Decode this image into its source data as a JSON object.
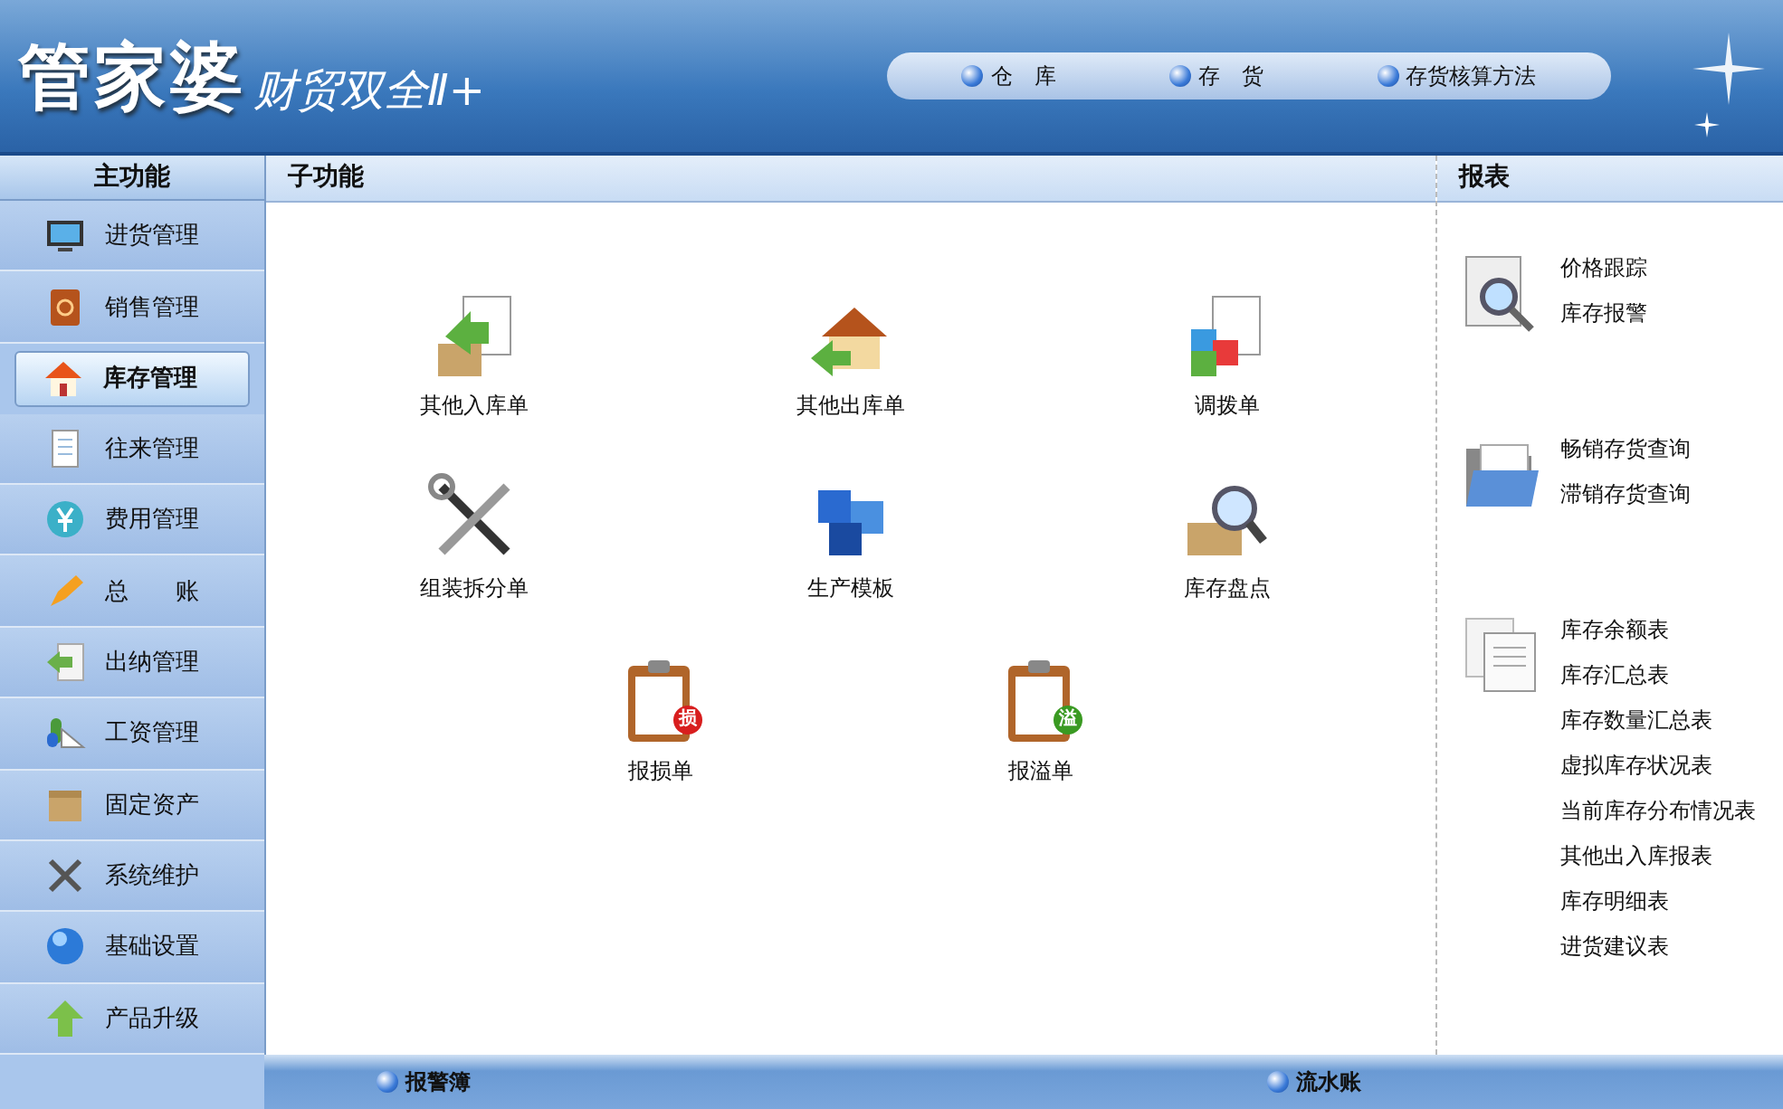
{
  "header": {
    "logo_main": "管家婆",
    "logo_sub": "财贸双全Ⅱ+",
    "nav": [
      {
        "label": "仓　库"
      },
      {
        "label": "存　货"
      },
      {
        "label": "存货核算方法"
      }
    ]
  },
  "sidebar": {
    "title": "主功能",
    "items": [
      {
        "label": "进货管理",
        "selected": false
      },
      {
        "label": "销售管理",
        "selected": false
      },
      {
        "label": "库存管理",
        "selected": true
      },
      {
        "label": "往来管理",
        "selected": false
      },
      {
        "label": "费用管理",
        "selected": false
      },
      {
        "label": "总　　账",
        "selected": false
      },
      {
        "label": "出纳管理",
        "selected": false
      },
      {
        "label": "工资管理",
        "selected": false
      },
      {
        "label": "固定资产",
        "selected": false
      },
      {
        "label": "系统维护",
        "selected": false
      },
      {
        "label": "基础设置",
        "selected": false
      },
      {
        "label": "产品升级",
        "selected": false
      }
    ]
  },
  "subfunctions": {
    "title": "子功能",
    "rows": [
      [
        {
          "label": "其他入库单"
        },
        {
          "label": "其他出库单"
        },
        {
          "label": "调拨单"
        }
      ],
      [
        {
          "label": "组装拆分单"
        },
        {
          "label": "生产模板"
        },
        {
          "label": "库存盘点"
        }
      ],
      [
        {
          "label": "报损单",
          "badge": "损",
          "color": "#d81e1e"
        },
        {
          "label": "报溢单",
          "badge": "溢",
          "color": "#3a9a22"
        }
      ]
    ]
  },
  "reports": {
    "title": "报表",
    "groups": [
      {
        "items": [
          "价格跟踪",
          "库存报警"
        ]
      },
      {
        "items": [
          "畅销存货查询",
          "滞销存货查询"
        ]
      },
      {
        "items": [
          "库存余额表",
          "库存汇总表",
          "库存数量汇总表",
          "虚拟库存状况表",
          "当前库存分布情况表",
          "其他出入库报表",
          "库存明细表",
          "进货建议表"
        ]
      }
    ]
  },
  "footer": {
    "links": [
      {
        "label": "报警簿"
      },
      {
        "label": "流水账"
      }
    ]
  }
}
